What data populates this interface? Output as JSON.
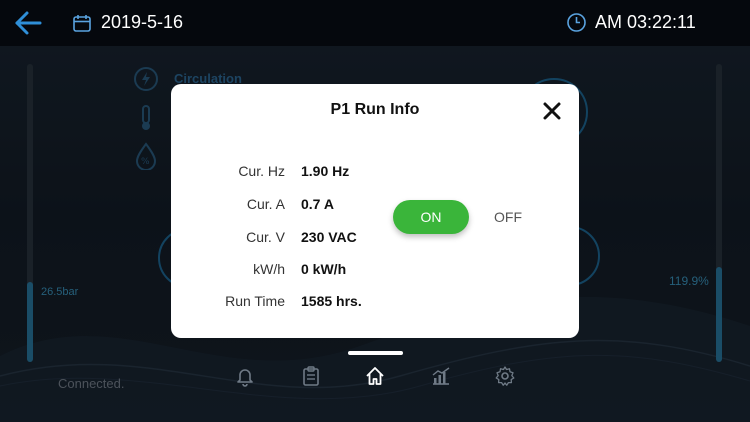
{
  "header": {
    "date": "2019-5-16",
    "time": "AM 03:22:11"
  },
  "dashboard": {
    "circulation_label": "Circulation",
    "pressure_label": "26.5bar",
    "percent_label": "119.9%",
    "connection_status": "Connected.",
    "pressure_level_fraction": 0.27,
    "percent_level_fraction": 0.32
  },
  "modal": {
    "title": "P1 Run Info",
    "rows": [
      {
        "label": "Cur. Hz",
        "value": "1.90 Hz"
      },
      {
        "label": "Cur. A",
        "value": "0.7 A"
      },
      {
        "label": "Cur. V",
        "value": "230 VAC"
      },
      {
        "label": "kW/h",
        "value": "0 kW/h"
      },
      {
        "label": "Run Time",
        "value": "1585 hrs."
      }
    ],
    "on_label": "ON",
    "off_label": "OFF",
    "state": "on"
  },
  "nav": {
    "items": [
      {
        "icon": "bell-icon"
      },
      {
        "icon": "clipboard-icon"
      },
      {
        "icon": "home-icon",
        "active": true
      },
      {
        "icon": "chart-icon"
      },
      {
        "icon": "gear-icon"
      }
    ]
  },
  "colors": {
    "accent_blue": "#2f8fd8",
    "on_green": "#3ab53a",
    "gauge_blue": "#2b7da6",
    "topbar": "#05080d"
  }
}
